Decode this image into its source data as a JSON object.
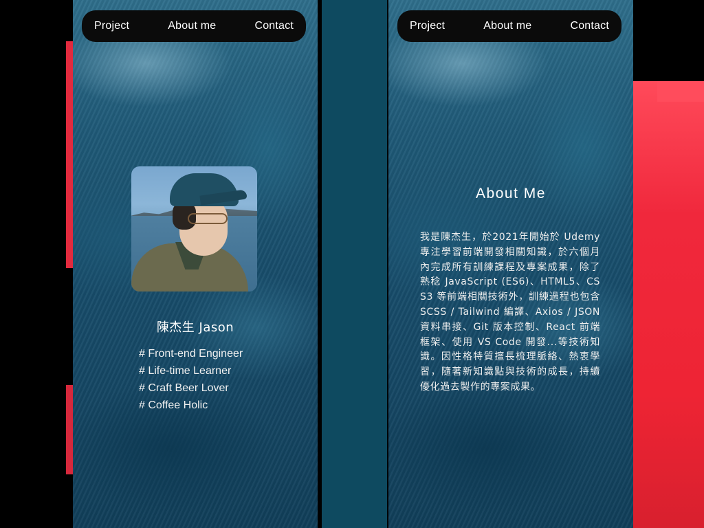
{
  "nav": {
    "items": [
      "Project",
      "About me",
      "Contact"
    ]
  },
  "profile": {
    "name": "陳杰生 Jason",
    "tags": [
      "# Front-end Engineer",
      "# Life-time Learner",
      "# Craft Beer Lover",
      "# Coffee Holic"
    ]
  },
  "about": {
    "title": "About Me",
    "body": "我是陳杰生，於2021年開始於 Udemy 專注學習前端開發相關知識，於六個月內完成所有訓練課程及專案成果，除了熟稔 JavaScript (ES6)、HTML5、CSS3 等前端相關技術外，訓練過程也包含 SCSS / Tailwind 編譯、Axios / JSON 資料串接、Git 版本控制、React 前端框架、使用 VS Code 開發...等技術知識。因性格特質擅長梳理脈絡、熱衷學習，隨著新知識點與技術的成長，持續優化過去製作的專案成果。"
  },
  "colors": {
    "panel": "#1a5373",
    "navbar": "#0b0b0b",
    "accent_red": "#f0283c"
  }
}
